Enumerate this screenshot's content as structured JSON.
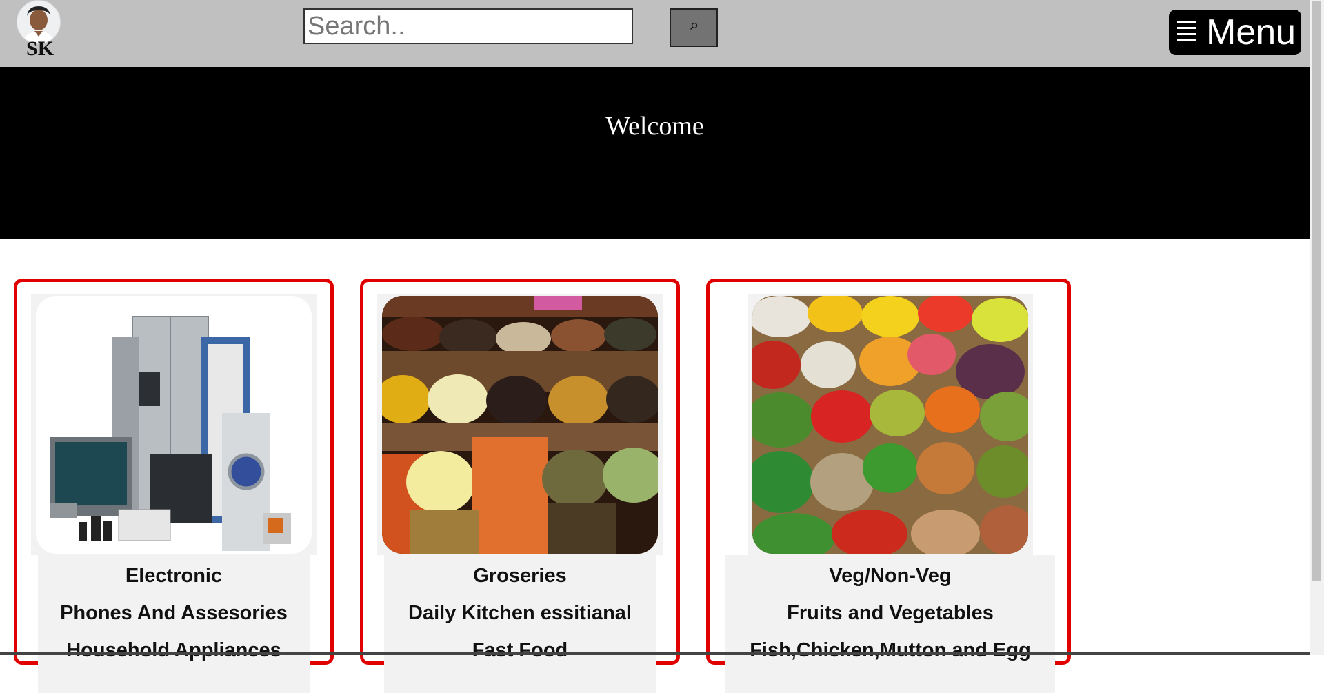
{
  "header": {
    "avatar_initials": "SK",
    "search": {
      "placeholder": "Search..",
      "value": ""
    },
    "search_icon": "search-icon",
    "menu": {
      "icon": "hamburger-icon",
      "label": "Menu"
    }
  },
  "hero": {
    "title": "Welcome"
  },
  "cards": [
    {
      "image": "electronics-appliances",
      "lines": [
        "Electronic",
        "Phones And Assesories",
        "Household Appliances"
      ]
    },
    {
      "image": "spices-groceries",
      "lines": [
        "Groseries",
        "Daily Kitchen essitianal",
        "Fast Food"
      ]
    },
    {
      "image": "fruits-vegetables",
      "lines": [
        "Veg/Non-Veg",
        "Fruits and Vegetables",
        "Fish,Chicken,Mutton and Egg"
      ]
    }
  ],
  "colors": {
    "topbar": "#c0c0c0",
    "hero": "#000000",
    "card_border": "#e00000",
    "card_bg": "#f2f2f2"
  }
}
